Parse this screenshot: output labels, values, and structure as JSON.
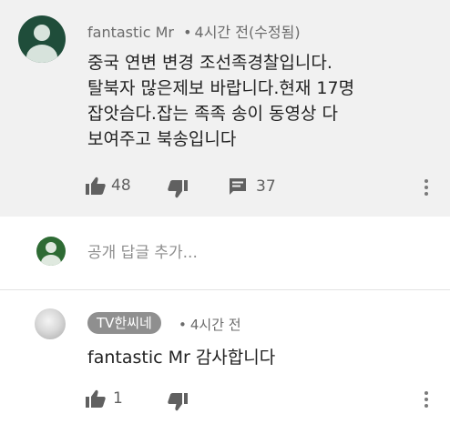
{
  "comment": {
    "author": "fantastic Mr",
    "separator": "•",
    "time": "4시간 전(수정됨)",
    "lines": [
      "중국 연변 변경 조선족경찰입니다.",
      "탈북자 많은제보 바랍니다.현재 17명",
      "잡앗슴다.잡는 족족 송이 동영상 다",
      "보여주고 북송입니다"
    ],
    "like_count": "48",
    "reply_count": "37",
    "avatar_color": "#1f4d3a"
  },
  "reply_box": {
    "placeholder": "공개 답글 추가...",
    "avatar_color": "#2e6b34"
  },
  "reply": {
    "author_chip": "TV한씨네",
    "separator": "•",
    "time": "4시간 전",
    "text": "fantastic Mr 감사합니다",
    "like_count": "1"
  }
}
